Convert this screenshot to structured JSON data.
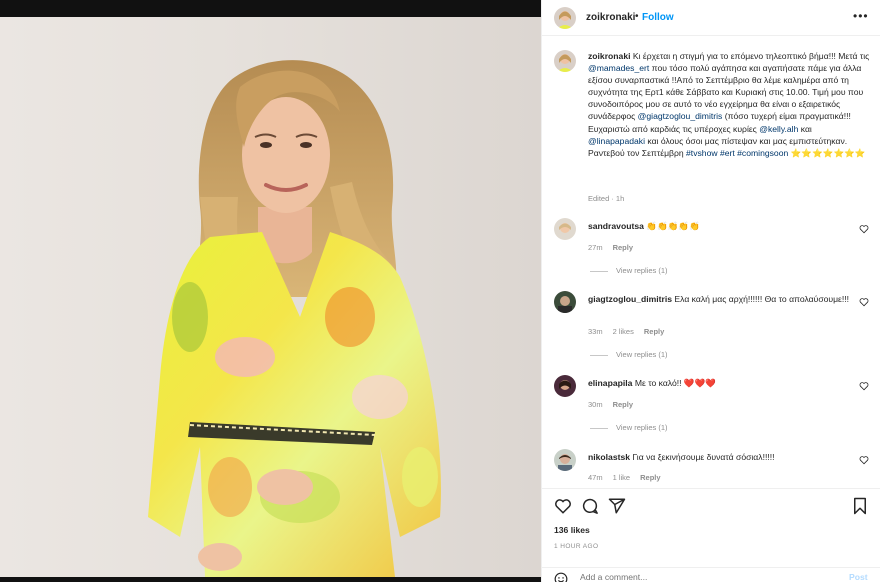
{
  "post": {
    "username": "zoikronaki",
    "separator": "•",
    "follow_label": "Follow",
    "more_label": "•••"
  },
  "caption": {
    "username": "zoikronaki",
    "segments": [
      {
        "t": " Κι έρχεται η στιγμή για το επόμενο τηλεοπτικό βήμα!!! Μετά τις "
      },
      {
        "t": "@mamades_ert",
        "tag": true
      },
      {
        "t": " που τόσο πολύ αγάπησα και αγαπήσατε πάμε για άλλα εξίσου συναρπαστικά !!Από το Σεπτέμβριο θα λέμε καλημέρα από τη συχνότητα της Ερτ1 κάθε Σάββατο και Κυριακή στις 10.00. Τιμή μου που συνοδοιπόρος μου σε αυτό το νέο εγχείρημα θα είναι ο εξαιρετικός συνάδερφος "
      },
      {
        "t": "@giagtzoglou_dimitris",
        "tag": true
      },
      {
        "t": " (πόσο τυχερή είμαι πραγματικά!!! Ευχαριστώ από καρδιάς τις υπέροχες κυρίες "
      },
      {
        "t": "@kelly.alh",
        "tag": true
      },
      {
        "t": " και "
      },
      {
        "t": "@linapapadaki",
        "tag": true
      },
      {
        "t": " και όλους όσοι μας πίστεψαν και μας εμπιστεύτηκαν. Ραντεβού τον Σεπτέμβρη "
      },
      {
        "t": "#tvshow",
        "tag": true
      },
      {
        "t": " "
      },
      {
        "t": "#ert",
        "tag": true
      },
      {
        "t": " "
      },
      {
        "t": "#comingsoon",
        "tag": true
      },
      {
        "t": " ⭐⭐⭐⭐⭐⭐⭐"
      }
    ],
    "edited": "Edited · 1h"
  },
  "comments": [
    {
      "username": "sandravoutsa",
      "text": "👏👏👏👏👏",
      "time": "27m",
      "likes": "",
      "reply": "Reply",
      "view_replies": "View replies (1)"
    },
    {
      "username": "giagtzoglou_dimitris",
      "text": "Ελα καλή μας αρχή!!!!!! Θα το απολαύσουμε!!!",
      "time": "33m",
      "likes": "2 likes",
      "reply": "Reply",
      "view_replies": "View replies (1)"
    },
    {
      "username": "elinapapila",
      "text": "Με το καλό!! ❤️❤️❤️",
      "time": "30m",
      "likes": "",
      "reply": "Reply",
      "view_replies": "View replies (1)"
    },
    {
      "username": "nikolastsk",
      "text": "Για να ξεκινήσουμε δυνατά σόσιαλ!!!!!",
      "time": "47m",
      "likes": "1 like",
      "reply": "Reply",
      "view_replies": ""
    }
  ],
  "actions": {
    "likes": "136 likes",
    "time_ago": "1 HOUR AGO",
    "add_comment_placeholder": "Add a comment...",
    "post_label": "Post"
  },
  "icons": [
    "ellipsis-icon",
    "heart-icon",
    "comment-icon",
    "share-icon",
    "bookmark-icon",
    "emoji-icon"
  ],
  "colors": {
    "link_blue": "#0095f6",
    "tag_blue": "#00376b",
    "muted": "#8e8e8e",
    "text": "#262626"
  }
}
